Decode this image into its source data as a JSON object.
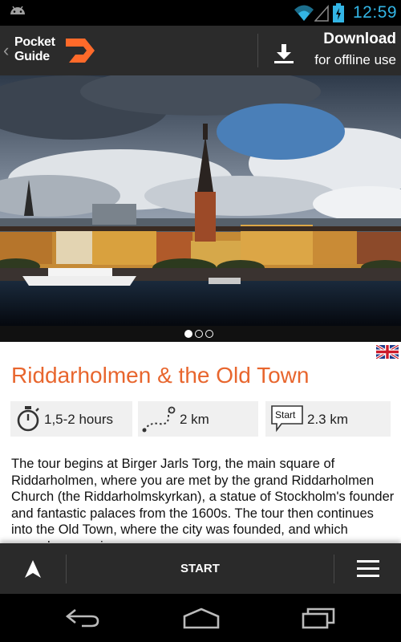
{
  "status_bar": {
    "time": "12:59",
    "time_color": "#33b5e5",
    "icons": [
      "android-icon",
      "wifi-icon",
      "signal-icon",
      "battery-icon"
    ]
  },
  "action_bar": {
    "logo_line1": "Pocket",
    "logo_line2": "Guide",
    "download_title": "Download",
    "download_subtitle": "for offline use",
    "accent": "#ff6a2a"
  },
  "carousel": {
    "page_count": 3,
    "active_index": 0
  },
  "tour": {
    "title": "Riddarholmen & the Old Town",
    "title_color": "#e8662e",
    "duration": "1,5-2 hours",
    "distance": "2 km",
    "start_label": "Start",
    "start_distance": "2.3 km",
    "description": "The tour begins at Birger Jarls Torg, the main square of Riddarholmen, where you are met by the grand Riddarholmen Church (the Riddarholmskyrkan), a statue of Stockholm's founder and fantastic palaces from the 1600s. The tour then continues into the Old Town, where the city was founded, and which nowadays receives"
  },
  "bottom_bar": {
    "start_button": "START"
  },
  "language": "english-flag-icon"
}
